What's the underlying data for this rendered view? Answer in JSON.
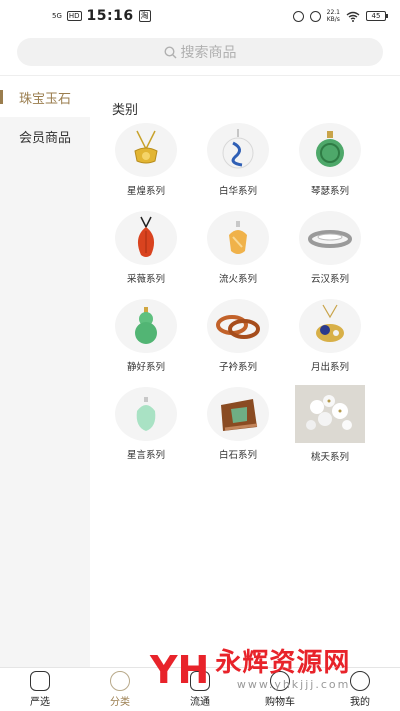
{
  "status_bar": {
    "signal_label": "5G",
    "hd_label": "HD",
    "time": "15:16",
    "app_badge": "淘",
    "net_speed": "22.1",
    "net_unit": "KB/s",
    "battery": "45"
  },
  "search": {
    "placeholder": "搜索商品"
  },
  "sidebar": {
    "items": [
      {
        "label": "珠宝玉石",
        "active": true
      },
      {
        "label": "会员商品",
        "active": false
      }
    ]
  },
  "main": {
    "section_title": "类别",
    "categories": [
      {
        "label": "星煌系列",
        "icon": "gold-pendant"
      },
      {
        "label": "白华系列",
        "icon": "jade-ring"
      },
      {
        "label": "琴瑟系列",
        "icon": "green-jade-pendant"
      },
      {
        "label": "采薇系列",
        "icon": "red-leaf-pendant"
      },
      {
        "label": "流火系列",
        "icon": "amber-pendant"
      },
      {
        "label": "云汉系列",
        "icon": "silver-ring"
      },
      {
        "label": "静好系列",
        "icon": "green-gourd-pendant"
      },
      {
        "label": "子衿系列",
        "icon": "bangles"
      },
      {
        "label": "月出系列",
        "icon": "cat-pendant"
      },
      {
        "label": "星言系列",
        "icon": "pale-jade-pendant"
      },
      {
        "label": "白石系列",
        "icon": "stone-ring"
      },
      {
        "label": "桃夭系列",
        "icon": "flowers"
      }
    ]
  },
  "tabbar": {
    "items": [
      {
        "label": "严选",
        "active": false
      },
      {
        "label": "分类",
        "active": true
      },
      {
        "label": "流通",
        "active": false
      },
      {
        "label": "购物车",
        "active": false
      },
      {
        "label": "我的",
        "active": false
      }
    ]
  },
  "watermark": {
    "logo": "YH",
    "title": "永辉资源网",
    "url": "www.yhkjjj.com"
  },
  "colors": {
    "accent": "#9a7d4e",
    "sidebar_bg": "#f5f5f5",
    "watermark_red": "#e8232a"
  }
}
